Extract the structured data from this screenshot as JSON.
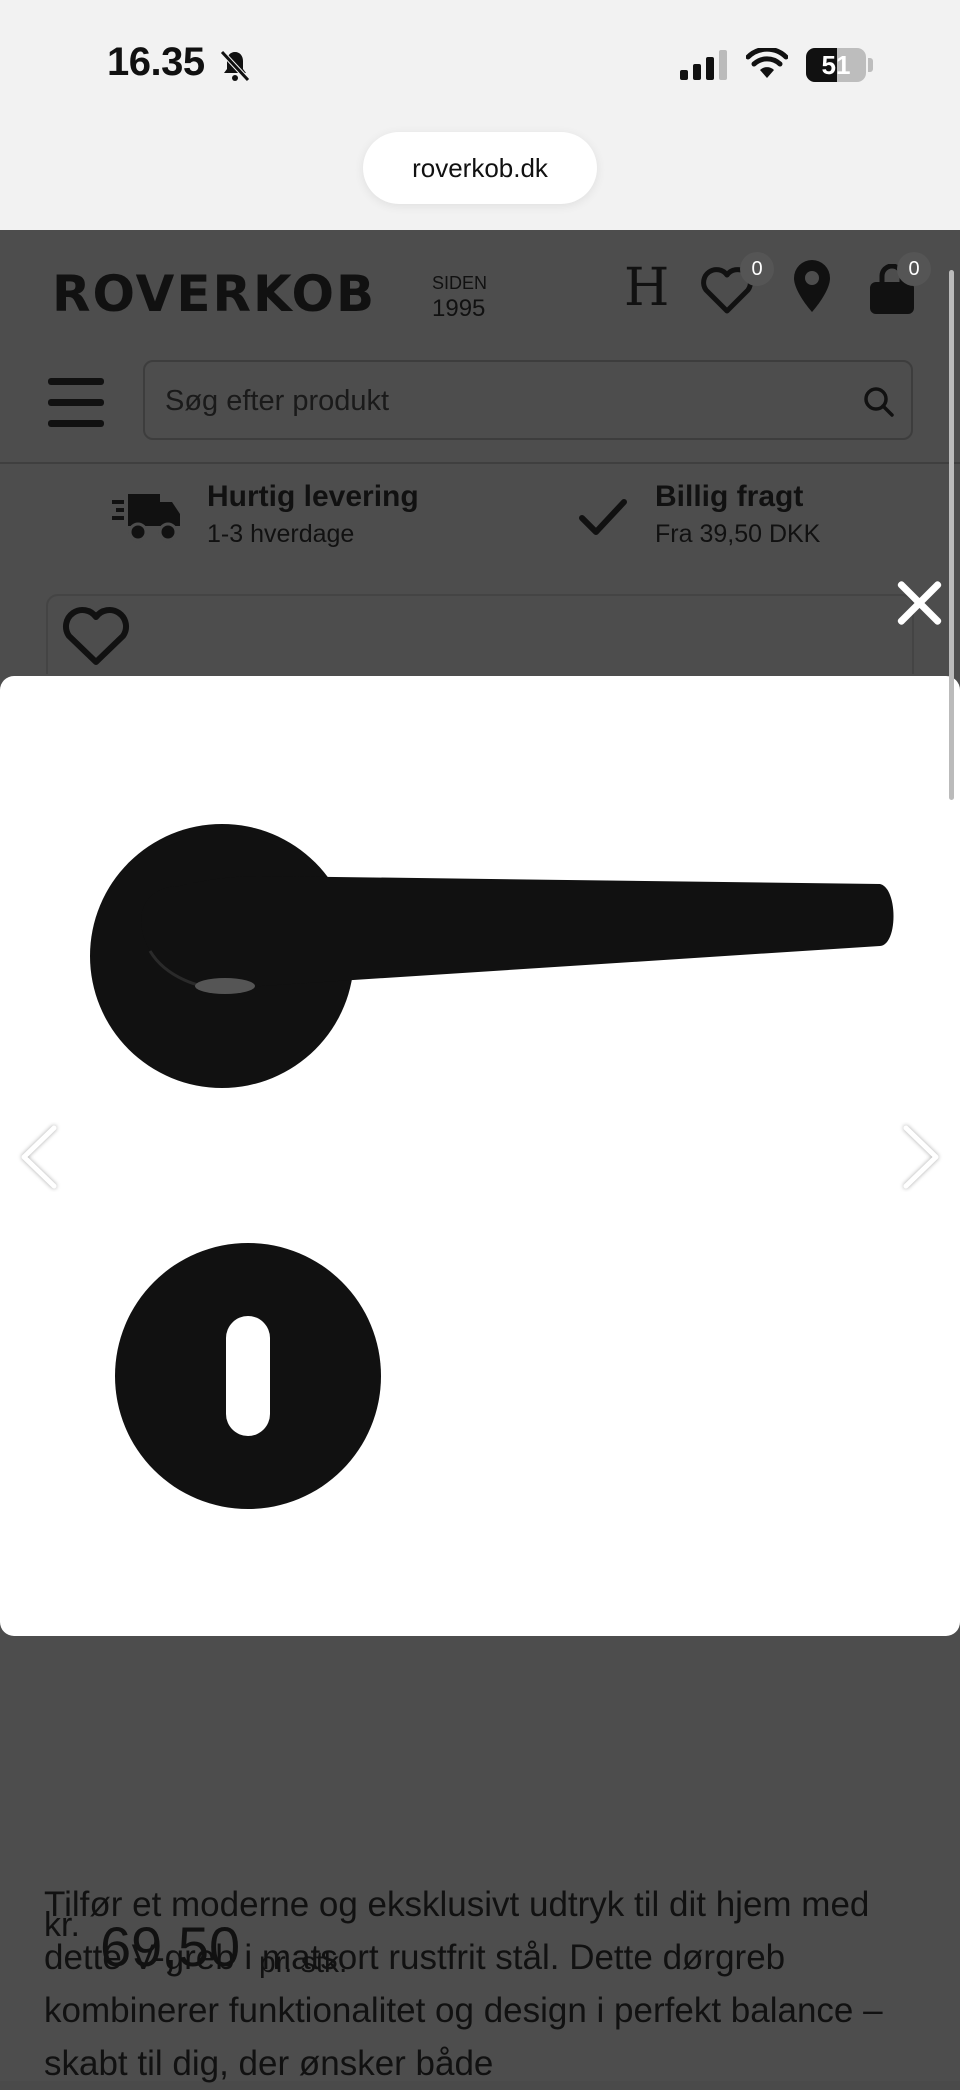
{
  "status_bar": {
    "time": "16.35",
    "battery": "51",
    "battery_level": 0.51
  },
  "browser": {
    "url": "roverkob.dk"
  },
  "header": {
    "brand": "ROVERKOB",
    "since_label": "SIDEN",
    "since_year": "1995",
    "h_icon_label": "H",
    "wishlist_count": "0",
    "cart_count": "0",
    "search_placeholder": "Søg efter produkt"
  },
  "usps": [
    {
      "title": "Hurtig levering",
      "subtitle": "1-3 hverdage",
      "icon": "delivery-truck-icon"
    },
    {
      "title": "Billig fragt",
      "subtitle": "Fra 39,50 DKK",
      "icon": "checkmark-icon"
    }
  ],
  "product": {
    "price_currency": "kr.",
    "price_value": "69,50",
    "price_unit": "pr. stk.",
    "description": "Tilfør et moderne og eksklusivt udtryk til dit hjem med dette V-greb i matsort rustfrit stål. Dette dørgreb kombinerer funktionalitet og design i perfekt balance – skabt til dig, der ønsker både"
  },
  "colors": {
    "overlay": "#4d4d4d",
    "status_bg": "#f2f2f2",
    "product_black": "#111111"
  }
}
